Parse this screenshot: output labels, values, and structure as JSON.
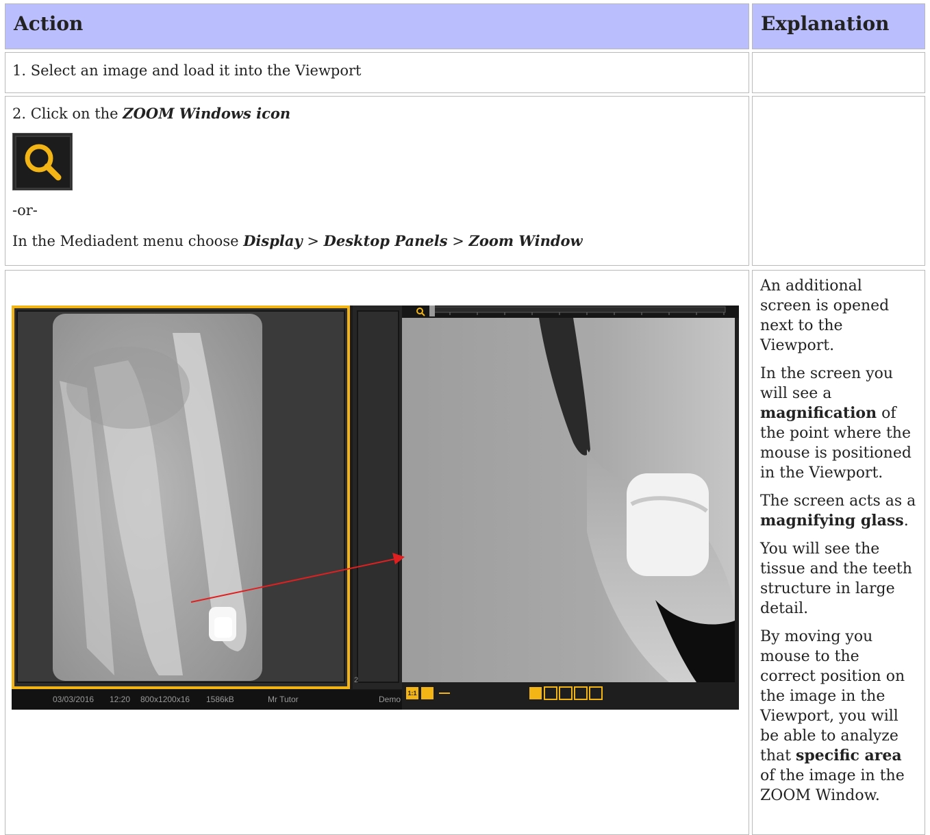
{
  "table": {
    "headers": {
      "action": "Action",
      "explanation": "Explanation"
    },
    "row1": {
      "action": "1. Select an image and load it into the Viewport"
    },
    "row2": {
      "click_prefix": "2. Click on the ",
      "click_em": "ZOOM Windows icon",
      "or": "-or-",
      "menu_prefix": "In the Mediadent menu choose ",
      "menu_display": "Display",
      "sep1": " > ",
      "menu_panels": "Desktop Panels",
      "sep2": " > ",
      "menu_zoom": "Zoom Window"
    },
    "row3": {
      "explanation": [
        {
          "plain": "An additional screen is opened next to the Viewport."
        },
        {
          "pre": "In the screen you will see a ",
          "bold": "magnification",
          "post": " of the point where the mouse is positioned in the Viewport."
        },
        {
          "pre": "The screen acts as a ",
          "bold": "magnifying glass",
          "post": "."
        },
        {
          "plain": "You will see the tissue and the teeth structure in large detail."
        },
        {
          "pre": "By moving you mouse to the correct position on the image in the Viewport, you will be able to analyze that ",
          "bold": "specific area",
          "post": " of the image in the ZOOM Window."
        }
      ]
    }
  },
  "screenshot": {
    "status": {
      "date": "03/03/2016",
      "time": "12:20",
      "dims": "800x1200x16",
      "size": "1586kB",
      "patient": "Mr Tutor",
      "demo": "Demo"
    },
    "page_number": "2",
    "zoom_ratio": "1:1",
    "accent": "#f2b515"
  }
}
